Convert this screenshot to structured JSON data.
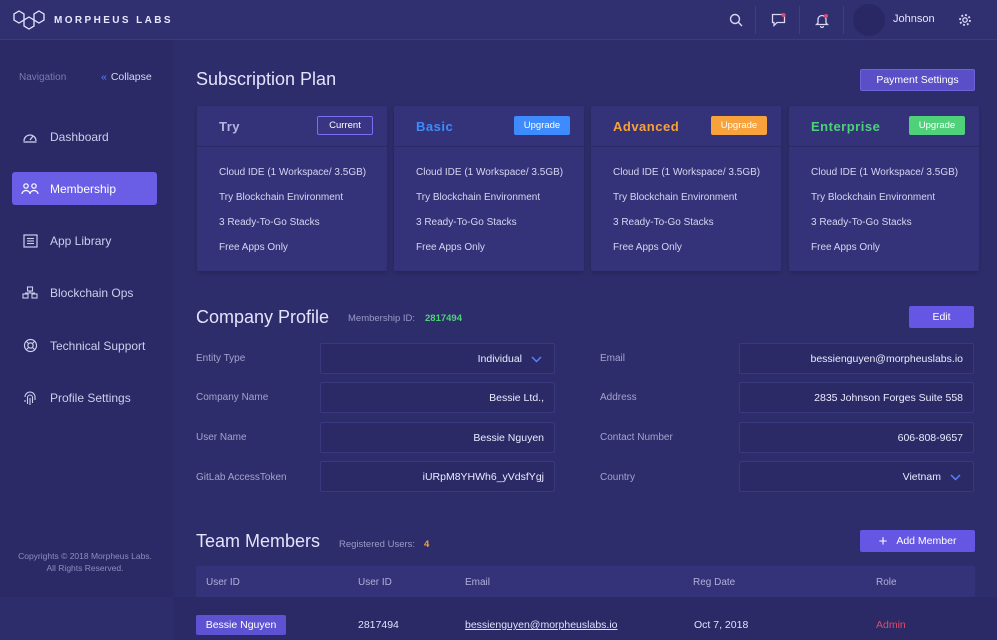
{
  "app": {
    "logo_text": "MORPHEUS LABS",
    "username": "Johnson"
  },
  "colors": {
    "accent": "#6a5ee6",
    "basic": "#3d8bfd",
    "advanced": "#f7a23b",
    "enterprise": "#4fd17a",
    "admin": "#e24a6b",
    "membership_id": "#4fd17a",
    "registered": "#f7a23b"
  },
  "sidebar": {
    "nav_label": "Navigation",
    "collapse_label": "Collapse",
    "items": [
      {
        "label": "Dashboard",
        "icon": "dashboard-icon"
      },
      {
        "label": "Membership",
        "icon": "users-icon"
      },
      {
        "label": "App Library",
        "icon": "list-icon"
      },
      {
        "label": "Blockchain Ops",
        "icon": "blocks-icon"
      },
      {
        "label": "Technical Support",
        "icon": "support-icon"
      },
      {
        "label": "Profile Settings",
        "icon": "fingerprint-icon"
      }
    ],
    "copyright_line1": "Copyrights © 2018 Morpheus Labs.",
    "copyright_line2": "All Rights Reserved."
  },
  "subscription": {
    "title": "Subscription Plan",
    "payment_button": "Payment Settings",
    "plans": [
      {
        "name": "Try",
        "button": "Current",
        "features": [
          "Cloud IDE (1 Workspace/ 3.5GB)",
          "Try Blockchain Environment",
          "3 Ready-To-Go Stacks",
          "Free Apps Only"
        ]
      },
      {
        "name": "Basic",
        "button": "Upgrade",
        "features": [
          "Cloud IDE (1 Workspace/ 3.5GB)",
          "Try Blockchain Environment",
          "3 Ready-To-Go Stacks",
          "Free Apps Only"
        ]
      },
      {
        "name": "Advanced",
        "button": "Upgrade",
        "features": [
          "Cloud IDE (1 Workspace/ 3.5GB)",
          "Try Blockchain Environment",
          "3 Ready-To-Go Stacks",
          "Free Apps Only"
        ]
      },
      {
        "name": "Enterprise",
        "button": "Upgrade",
        "features": [
          "Cloud IDE (1 Workspace/ 3.5GB)",
          "Try Blockchain Environment",
          "3 Ready-To-Go Stacks",
          "Free Apps Only"
        ]
      }
    ]
  },
  "company": {
    "title": "Company Profile",
    "membership_label": "Membership ID:",
    "membership_id": "2817494",
    "edit_button": "Edit",
    "fields": {
      "entity_type": {
        "label": "Entity Type",
        "value": "Individual"
      },
      "company_name": {
        "label": "Company Name",
        "value": "Bessie Ltd.,"
      },
      "user_name": {
        "label": "User Name",
        "value": "Bessie Nguyen"
      },
      "gitlab_token": {
        "label": "GitLab AccessToken",
        "value": "iURpM8YHWh6_yVdsfYgj"
      },
      "email": {
        "label": "Email",
        "value": "bessienguyen@morpheuslabs.io"
      },
      "address": {
        "label": "Address",
        "value": "2835 Johnson Forges Suite 558"
      },
      "contact": {
        "label": "Contact Number",
        "value": "606-808-9657"
      },
      "country": {
        "label": "Country",
        "value": "Vietnam"
      }
    }
  },
  "team": {
    "title": "Team Members",
    "registered_label": "Registered Users:",
    "registered_count": "4",
    "add_button": "Add Member",
    "columns": [
      "User ID",
      "User ID",
      "Email",
      "Reg Date",
      "Role"
    ],
    "rows": [
      {
        "name": "Bessie Nguyen",
        "id": "2817494",
        "email": "bessienguyen@morpheuslabs.io",
        "date": "Oct 7, 2018",
        "role": "Admin"
      }
    ]
  }
}
